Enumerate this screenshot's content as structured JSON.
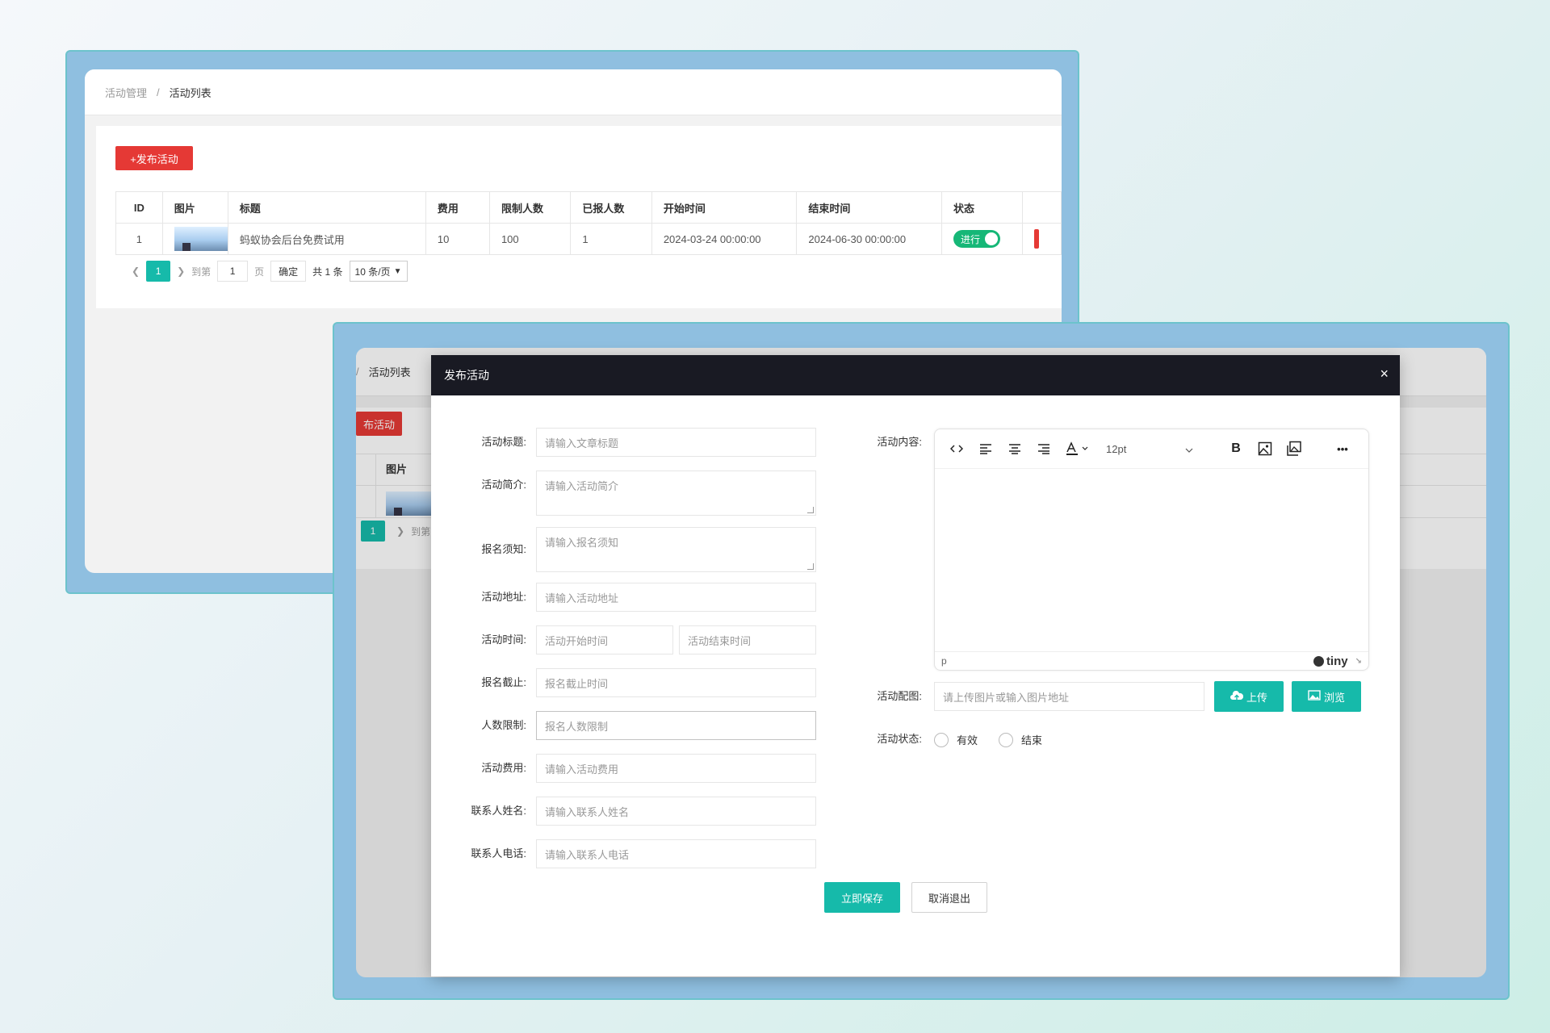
{
  "back_window": {
    "breadcrumb": {
      "parent": "活动管理",
      "separator": "/",
      "current": "活动列表"
    },
    "publish_button": "+发布活动",
    "table": {
      "headers": [
        "ID",
        "图片",
        "标题",
        "费用",
        "限制人数",
        "已报人数",
        "开始时间",
        "结束时间",
        "状态"
      ],
      "rows": [
        {
          "id": "1",
          "title": "蚂蚁协会后台免费试用",
          "fee": "10",
          "limit": "100",
          "enrolled": "1",
          "start": "2024-03-24 00:00:00",
          "end": "2024-06-30 00:00:00",
          "status": "进行"
        }
      ]
    },
    "pager": {
      "current": "1",
      "goto_label": "到第",
      "page_value": "1",
      "page_unit": "页",
      "confirm": "确定",
      "total": "共 1 条",
      "per_page": "10 条/页"
    }
  },
  "front_window": {
    "breadcrumb": {
      "separator": "/",
      "current": "活动列表"
    },
    "publish_button": "布活动",
    "table_header_image": "图片",
    "pager": {
      "current": "1",
      "goto_label": "到第"
    }
  },
  "modal": {
    "title": "发布活动",
    "close": "×",
    "fields": {
      "title": {
        "label": "活动标题:",
        "placeholder": "请输入文章标题"
      },
      "intro": {
        "label": "活动简介:",
        "placeholder": "请输入活动简介"
      },
      "notice": {
        "label": "报名须知:",
        "placeholder": "请输入报名须知"
      },
      "address": {
        "label": "活动地址:",
        "placeholder": "请输入活动地址"
      },
      "time": {
        "label": "活动时间:",
        "start_placeholder": "活动开始时间",
        "end_placeholder": "活动结束时间"
      },
      "deadline": {
        "label": "报名截止:",
        "placeholder": "报名截止时间"
      },
      "limit": {
        "label": "人数限制:",
        "placeholder": "报名人数限制"
      },
      "fee": {
        "label": "活动费用:",
        "placeholder": "请输入活动费用"
      },
      "contact_name": {
        "label": "联系人姓名:",
        "placeholder": "请输入联系人姓名"
      },
      "contact_phone": {
        "label": "联系人电话:",
        "placeholder": "请输入联系人电话"
      }
    },
    "content": {
      "label": "活动内容:",
      "font_size": "12pt",
      "status_path": "p",
      "brand": "tiny",
      "toolbar_icons": [
        "code-icon",
        "align-left-icon",
        "align-center-icon",
        "align-right-icon",
        "text-color-icon",
        "bold-icon",
        "image-icon",
        "gallery-icon",
        "more-icon"
      ]
    },
    "cover": {
      "label": "活动配图:",
      "placeholder": "请上传图片或输入图片地址",
      "upload": "上传",
      "browse": "浏览"
    },
    "status": {
      "label": "活动状态:",
      "options": [
        "有效",
        "结束"
      ]
    },
    "save": "立即保存",
    "cancel": "取消退出"
  },
  "colors": {
    "accent": "#16baaa",
    "danger": "#e53935",
    "modal_header": "#191a23",
    "switch_on": "#16b777"
  }
}
